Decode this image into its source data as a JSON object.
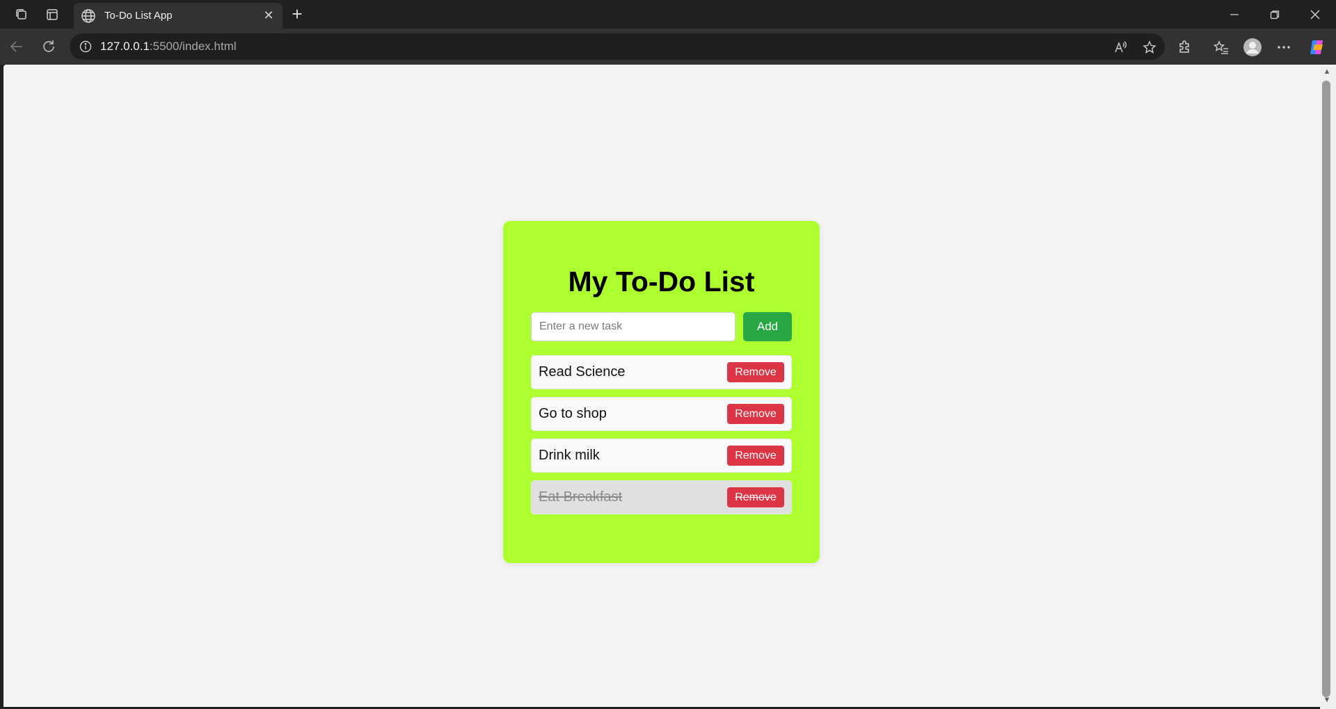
{
  "browser": {
    "tab_title": "To-Do List App",
    "new_tab_symbol": "+",
    "url_host": "127.0.0.1",
    "url_rest": ":5500/index.html"
  },
  "icons": {
    "workspaces": "workspaces-icon",
    "tab_actions": "tab-actions-icon",
    "globe": "globe-icon",
    "back": "back-arrow-icon",
    "reload": "reload-icon",
    "info": "info-icon",
    "read_aloud": "read-aloud-icon",
    "favorite": "star-icon",
    "extensions": "extensions-icon",
    "favorites_list": "favorites-list-icon",
    "profile": "profile-icon",
    "more": "more-icon",
    "copilot": "copilot-icon"
  },
  "app": {
    "heading": "My To-Do List",
    "input_placeholder": "Enter a new task",
    "input_value": "",
    "add_label": "Add",
    "tasks": [
      {
        "text": "Read Science",
        "done": false,
        "remove_label": "Remove"
      },
      {
        "text": "Go to shop",
        "done": false,
        "remove_label": "Remove"
      },
      {
        "text": "Drink milk",
        "done": false,
        "remove_label": "Remove"
      },
      {
        "text": "Eat Breakfast",
        "done": true,
        "remove_label": "Remove"
      }
    ]
  },
  "colors": {
    "card_bg": "#adff2f",
    "add_button": "#28a745",
    "remove_button": "#dc3545",
    "page_bg": "#f4f4f4"
  }
}
